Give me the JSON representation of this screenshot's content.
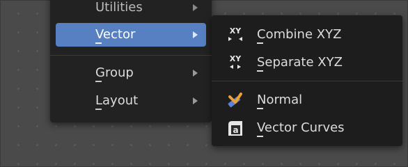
{
  "menu": {
    "items": [
      {
        "label": "Utilities",
        "icon": "chevron-right-icon"
      },
      {
        "label": "Vector",
        "icon": "chevron-right-icon",
        "state": "highlighted"
      },
      {
        "label": "Group",
        "icon": "chevron-right-icon"
      },
      {
        "label": "Layout",
        "icon": "chevron-right-icon"
      }
    ]
  },
  "submenu": {
    "items": [
      {
        "label": "Combine XYZ",
        "icon": "combine-xyz-icon",
        "icon_text": "XY"
      },
      {
        "label": "Separate XYZ",
        "icon": "separate-xyz-icon",
        "icon_text": "XY"
      },
      {
        "label": "Normal",
        "icon": "normal-icon"
      },
      {
        "label": "Vector Curves",
        "icon": "vector-curves-icon",
        "icon_text": "a"
      }
    ]
  },
  "colors": {
    "highlight": "#5680c2",
    "menu_bg": "#222222",
    "submenu_bg": "#1d1d1d",
    "canvas_bg": "#4a4a4a",
    "normal_icon_blue": "#5a83d6",
    "normal_icon_orange": "#f0a030"
  }
}
